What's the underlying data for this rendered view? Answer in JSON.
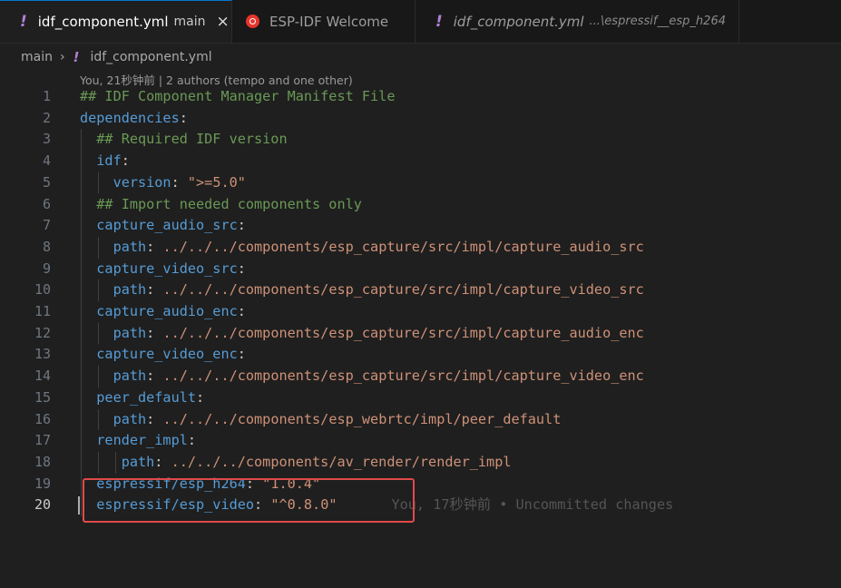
{
  "tabs": [
    {
      "icon": "!",
      "label": "idf_component.yml",
      "description": "main",
      "close": "×",
      "active": true
    },
    {
      "label": "ESP-IDF Welcome",
      "active": false
    },
    {
      "icon": "!",
      "label": "idf_component.yml",
      "description": "...\\espressif__esp_h264",
      "active": false
    }
  ],
  "breadcrumb": {
    "folder": "main",
    "separator": "›",
    "icon": "!",
    "file": "idf_component.yml"
  },
  "codelens": "You, 21秒钟前 | 2 authors (tempo and one other)",
  "editor": {
    "lines": [
      {
        "num": "1",
        "tokens": [
          {
            "t": "## IDF Component Manager Manifest File",
            "c": "comment"
          }
        ]
      },
      {
        "num": "2",
        "tokens": [
          {
            "t": "dependencies",
            "c": "key"
          },
          {
            "t": ":",
            "c": "punct"
          }
        ]
      },
      {
        "num": "3",
        "tokens": [
          {
            "t": "  ## Required IDF version",
            "c": "comment"
          }
        ]
      },
      {
        "num": "4",
        "tokens": [
          {
            "t": "  idf",
            "c": "key"
          },
          {
            "t": ":",
            "c": "punct"
          }
        ]
      },
      {
        "num": "5",
        "tokens": [
          {
            "t": "    version",
            "c": "key"
          },
          {
            "t": ": ",
            "c": "punct"
          },
          {
            "t": "\">=5.0\"",
            "c": "str"
          }
        ]
      },
      {
        "num": "6",
        "tokens": [
          {
            "t": "  ## Import needed components only",
            "c": "comment"
          }
        ]
      },
      {
        "num": "7",
        "tokens": [
          {
            "t": "  capture_audio_src",
            "c": "key"
          },
          {
            "t": ":",
            "c": "punct"
          }
        ]
      },
      {
        "num": "8",
        "tokens": [
          {
            "t": "    path",
            "c": "key"
          },
          {
            "t": ": ",
            "c": "punct"
          },
          {
            "t": "../../../components/esp_capture/src/impl/capture_audio_src",
            "c": "str"
          }
        ]
      },
      {
        "num": "9",
        "tokens": [
          {
            "t": "  capture_video_src",
            "c": "key"
          },
          {
            "t": ":",
            "c": "punct"
          }
        ]
      },
      {
        "num": "10",
        "tokens": [
          {
            "t": "    path",
            "c": "key"
          },
          {
            "t": ": ",
            "c": "punct"
          },
          {
            "t": "../../../components/esp_capture/src/impl/capture_video_src",
            "c": "str"
          }
        ]
      },
      {
        "num": "11",
        "tokens": [
          {
            "t": "  capture_audio_enc",
            "c": "key"
          },
          {
            "t": ":",
            "c": "punct"
          }
        ]
      },
      {
        "num": "12",
        "tokens": [
          {
            "t": "    path",
            "c": "key"
          },
          {
            "t": ": ",
            "c": "punct"
          },
          {
            "t": "../../../components/esp_capture/src/impl/capture_audio_enc",
            "c": "str"
          }
        ]
      },
      {
        "num": "13",
        "tokens": [
          {
            "t": "  capture_video_enc",
            "c": "key"
          },
          {
            "t": ":",
            "c": "punct"
          }
        ]
      },
      {
        "num": "14",
        "tokens": [
          {
            "t": "    path",
            "c": "key"
          },
          {
            "t": ": ",
            "c": "punct"
          },
          {
            "t": "../../../components/esp_capture/src/impl/capture_video_enc",
            "c": "str"
          }
        ]
      },
      {
        "num": "15",
        "tokens": [
          {
            "t": "  peer_default",
            "c": "key"
          },
          {
            "t": ":",
            "c": "punct"
          }
        ]
      },
      {
        "num": "16",
        "tokens": [
          {
            "t": "    path",
            "c": "key"
          },
          {
            "t": ": ",
            "c": "punct"
          },
          {
            "t": "../../../components/esp_webrtc/impl/peer_default",
            "c": "str"
          }
        ]
      },
      {
        "num": "17",
        "tokens": [
          {
            "t": "  render_impl",
            "c": "key"
          },
          {
            "t": ":",
            "c": "punct"
          }
        ]
      },
      {
        "num": "18",
        "tokens": [
          {
            "t": "     path",
            "c": "key"
          },
          {
            "t": ": ",
            "c": "punct"
          },
          {
            "t": "../../../components/av_render/render_impl",
            "c": "str"
          }
        ]
      },
      {
        "num": "19",
        "tokens": [
          {
            "t": "  espressif/esp_h264",
            "c": "key"
          },
          {
            "t": ": ",
            "c": "punct"
          },
          {
            "t": "\"1.0.4\"",
            "c": "str"
          }
        ]
      },
      {
        "num": "20",
        "tokens": [
          {
            "t": "  espressif/esp_video",
            "c": "key"
          },
          {
            "t": ": ",
            "c": "punct"
          },
          {
            "t": "\"^0.8.0\"",
            "c": "str"
          }
        ],
        "blame": "You, 17秒钟前 • Uncommitted changes",
        "current": true
      }
    ]
  },
  "colors": {
    "comment": "#6a9955",
    "key": "#569cd6",
    "string": "#ce9178",
    "highlight_box": "#e04a4a",
    "active_tab_border": "#0078d4"
  }
}
